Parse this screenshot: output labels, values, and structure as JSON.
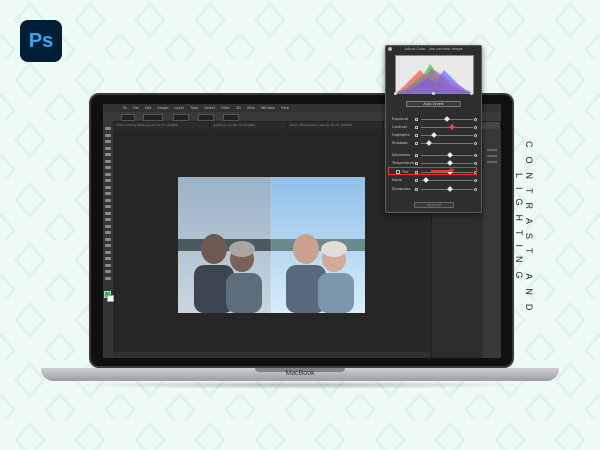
{
  "app": {
    "logo_text": "Ps",
    "tagline": "CONTRAST AND LIGHTING",
    "laptop_brand": "MacBook"
  },
  "menu": [
    "Ps",
    "File",
    "Edit",
    "Image",
    "Layer",
    "Type",
    "Select",
    "Filter",
    "3D",
    "View",
    "Window",
    "Help"
  ],
  "tabs": [
    {
      "label": "Photo editing tester.jpg @ 16.7% (RGB/8)",
      "active": false
    },
    {
      "label": "Untitled-1 @ 66.7% (RGB/8)",
      "active": false
    },
    {
      "label": "Photo Manipulation.psd @ 16.7% (RGB/8)",
      "active": false
    },
    {
      "label": "Photo-Editing tester.jpg @ 16.7% (RGB/8)",
      "active": true
    }
  ],
  "dialog": {
    "title": "Adjust Color - low contrast image",
    "auto_levels_label": "Auto Levels",
    "reset_label": "Reset All",
    "sliders": [
      {
        "label": "Exposure",
        "value": 0.5
      },
      {
        "label": "Contrast",
        "value": 0.6,
        "highlighted": true
      },
      {
        "label": "Highlights",
        "value": 0.25
      },
      {
        "label": "Shadows",
        "value": 0.15
      },
      {
        "label": "Saturation",
        "value": 0.55
      },
      {
        "label": "Temperature",
        "value": 0.55
      },
      {
        "label": "Tint",
        "value": 0.55
      },
      {
        "label": "Sepia",
        "value": 0.1
      },
      {
        "label": "Sharpness",
        "value": 0.55
      }
    ]
  },
  "colors": {
    "accent": "#31a8ff",
    "highlight": "#ff2a2a",
    "foreground_color": "#2fbf3a"
  }
}
